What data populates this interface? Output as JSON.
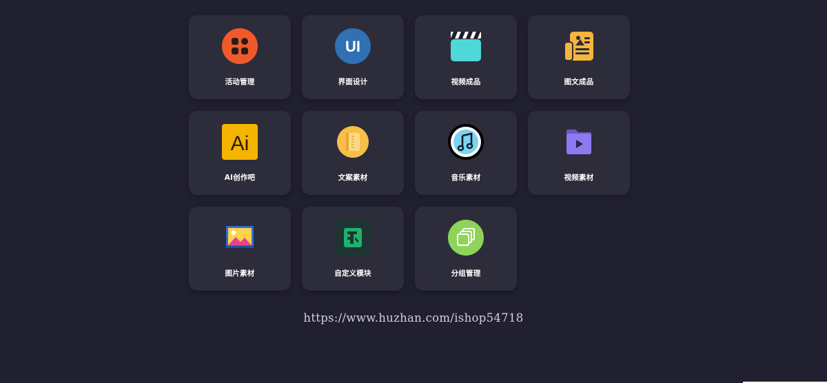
{
  "tiles": [
    {
      "label": "活动管理",
      "icon": "activity-grid-icon"
    },
    {
      "label": "界面设计",
      "icon": "ui-icon"
    },
    {
      "label": "视频成品",
      "icon": "clapperboard-icon"
    },
    {
      "label": "图文成品",
      "icon": "document-image-icon"
    },
    {
      "label": "AI创作吧",
      "icon": "ai-icon"
    },
    {
      "label": "文案素材",
      "icon": "notebook-icon"
    },
    {
      "label": "音乐素材",
      "icon": "music-note-icon"
    },
    {
      "label": "视频素材",
      "icon": "video-folder-icon"
    },
    {
      "label": "图片素材",
      "icon": "picture-icon"
    },
    {
      "label": "自定义模块",
      "icon": "custom-module-icon"
    },
    {
      "label": "分组管理",
      "icon": "layers-icon"
    }
  ],
  "icon_text": {
    "ui": "UI",
    "ai": "Ai"
  },
  "watermark": "https://www.huzhan.com/ishop54718",
  "colors": {
    "background": "#212030",
    "tile": "#2d2c3b",
    "activity": "#f05a2b",
    "ui": "#2f71b2",
    "clapper": "#4fd8d8",
    "document": "#f4b63c",
    "ai": "#f4b400",
    "notebook": "#f6bf47",
    "music": "#7bd3f0",
    "video_folder": "#8c7af0",
    "layers": "#8ed45a"
  }
}
